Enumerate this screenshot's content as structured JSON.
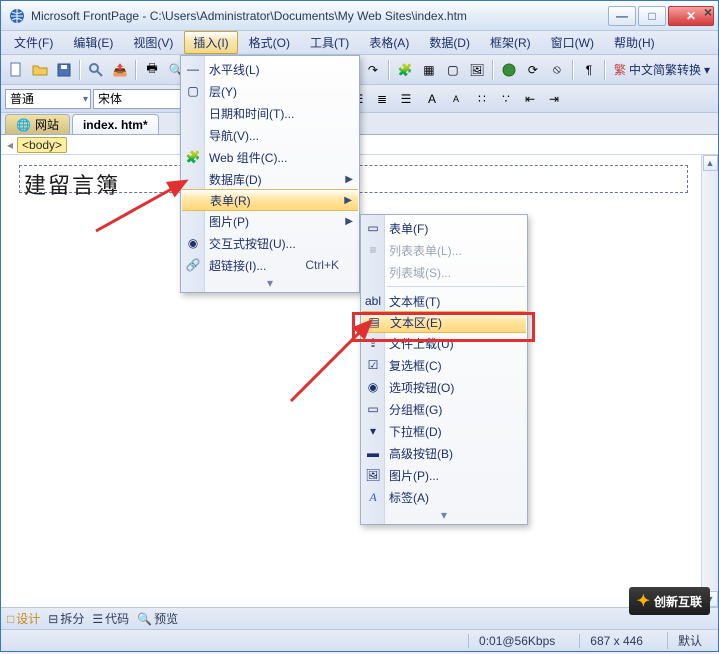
{
  "window": {
    "title": "Microsoft FrontPage - C:\\Users\\Administrator\\Documents\\My Web Sites\\index.htm"
  },
  "menubar": {
    "items": [
      {
        "label": "文件(F)"
      },
      {
        "label": "编辑(E)"
      },
      {
        "label": "视图(V)"
      },
      {
        "label": "插入(I)",
        "active": true
      },
      {
        "label": "格式(O)"
      },
      {
        "label": "工具(T)"
      },
      {
        "label": "表格(A)"
      },
      {
        "label": "数据(D)"
      },
      {
        "label": "框架(R)"
      },
      {
        "label": "窗口(W)"
      },
      {
        "label": "帮助(H)"
      }
    ]
  },
  "toolbar": {
    "convert_label": "中文简繁转换"
  },
  "format": {
    "style": "普通",
    "font": "宋体"
  },
  "tabs": {
    "site": "网站",
    "file": "index. htm*"
  },
  "pathbar": {
    "tag": "<body>"
  },
  "editor": {
    "heading": "建留言簿"
  },
  "insert_menu": {
    "items": [
      {
        "label": "水平线(L)"
      },
      {
        "label": "层(Y)"
      },
      {
        "label": "日期和时间(T)..."
      },
      {
        "label": "导航(V)..."
      },
      {
        "label": "Web 组件(C)..."
      },
      {
        "label": "数据库(D)",
        "sub": true
      },
      {
        "label": "表单(R)",
        "sub": true,
        "hl": true
      },
      {
        "label": "图片(P)",
        "sub": true
      },
      {
        "label": "交互式按钮(U)..."
      },
      {
        "label": "超链接(I)...",
        "shortcut": "Ctrl+K"
      }
    ]
  },
  "form_menu": {
    "items": [
      {
        "label": "表单(F)"
      },
      {
        "label": "列表表单(L)...",
        "disabled": true
      },
      {
        "label": "列表域(S)...",
        "disabled": true
      },
      {
        "label": "文本框(T)"
      },
      {
        "label": "文本区(E)",
        "hl": true
      },
      {
        "label": "文件上载(U)"
      },
      {
        "label": "复选框(C)"
      },
      {
        "label": "选项按钮(O)"
      },
      {
        "label": "分组框(G)"
      },
      {
        "label": "下拉框(D)"
      },
      {
        "label": "高级按钮(B)"
      },
      {
        "label": "图片(P)..."
      },
      {
        "label": "标签(A)"
      }
    ]
  },
  "footer": {
    "design": "设计",
    "split": "拆分",
    "code": "代码",
    "preview": "预览"
  },
  "status": {
    "speed": "0:01@56Kbps",
    "dim": "687 x 446",
    "mode": "默认"
  },
  "watermark": {
    "text": "创新互联"
  }
}
